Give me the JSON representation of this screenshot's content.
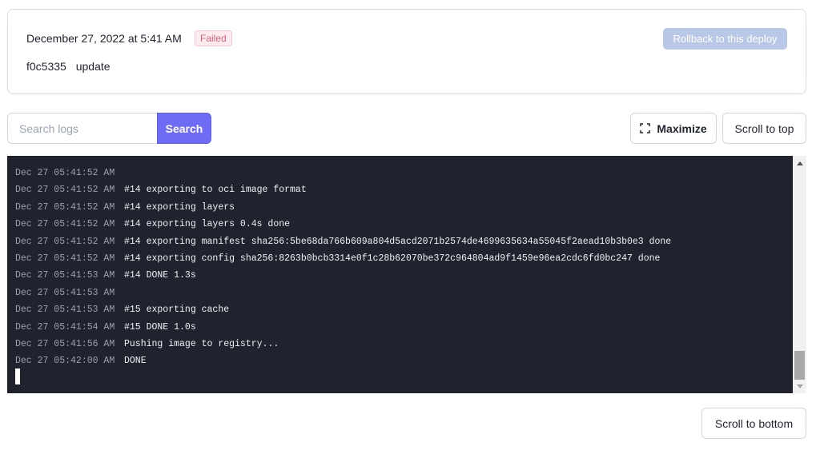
{
  "deploy": {
    "date": "December 27, 2022 at 5:41 AM",
    "status": "Failed",
    "commit_hash": "f0c5335",
    "commit_message": "update",
    "rollback_label": "Rollback to this deploy"
  },
  "toolbar": {
    "search_placeholder": "Search logs",
    "search_value": "",
    "search_label": "Search",
    "maximize_label": "Maximize",
    "scroll_top_label": "Scroll to top",
    "scroll_bottom_label": "Scroll to bottom"
  },
  "logs": [
    {
      "ts": "Dec 27 05:41:52 AM",
      "msg": ""
    },
    {
      "ts": "Dec 27 05:41:52 AM",
      "msg": "#14 exporting to oci image format"
    },
    {
      "ts": "Dec 27 05:41:52 AM",
      "msg": "#14 exporting layers"
    },
    {
      "ts": "Dec 27 05:41:52 AM",
      "msg": "#14 exporting layers 0.4s done"
    },
    {
      "ts": "Dec 27 05:41:52 AM",
      "msg": "#14 exporting manifest sha256:5be68da766b609a804d5acd2071b2574de4699635634a55045f2aead10b3b0e3 done"
    },
    {
      "ts": "Dec 27 05:41:52 AM",
      "msg": "#14 exporting config sha256:8263b0bcb3314e0f1c28b62070be372c964804ad9f1459e96ea2cdc6fd0bc247 done"
    },
    {
      "ts": "Dec 27 05:41:53 AM",
      "msg": "#14 DONE 1.3s"
    },
    {
      "ts": "Dec 27 05:41:53 AM",
      "msg": ""
    },
    {
      "ts": "Dec 27 05:41:53 AM",
      "msg": "#15 exporting cache"
    },
    {
      "ts": "Dec 27 05:41:54 AM",
      "msg": "#15 DONE 1.0s"
    },
    {
      "ts": "Dec 27 05:41:56 AM",
      "msg": "Pushing image to registry..."
    },
    {
      "ts": "Dec 27 05:42:00 AM",
      "msg": "DONE"
    }
  ],
  "icons": {
    "maximize": "maximize-icon",
    "scroll_up": "scroll-up-arrow-icon",
    "scroll_down": "scroll-down-arrow-icon"
  },
  "colors": {
    "accent": "#6e6cf5",
    "failed": "#e0607e",
    "log_bg": "#20232e",
    "rollback_disabled": "#b8c8e6"
  }
}
